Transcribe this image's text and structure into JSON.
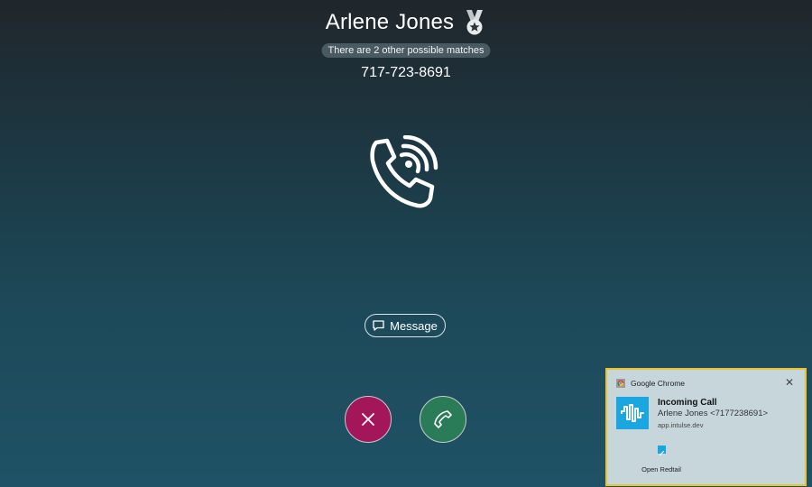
{
  "caller": {
    "name": "Arlene Jones",
    "matches_text": "There are 2 other possible matches",
    "number": "717-723-8691",
    "medal_icon": "medal-icon"
  },
  "center": {
    "icon": "ringing-phone-icon"
  },
  "actions": {
    "message_label": "Message",
    "decline_icon": "close-icon",
    "answer_icon": "phone-icon",
    "decline_color": "#a3175a",
    "answer_color": "#2a7b58"
  },
  "notification": {
    "app_name": "Google Chrome",
    "title": "Incoming Call",
    "body": "Arlene Jones <7177238691>",
    "source": "app.intulse.dev",
    "action_label": "Open Redtail",
    "close_glyph": "✕",
    "border_color": "#e8c52c"
  }
}
